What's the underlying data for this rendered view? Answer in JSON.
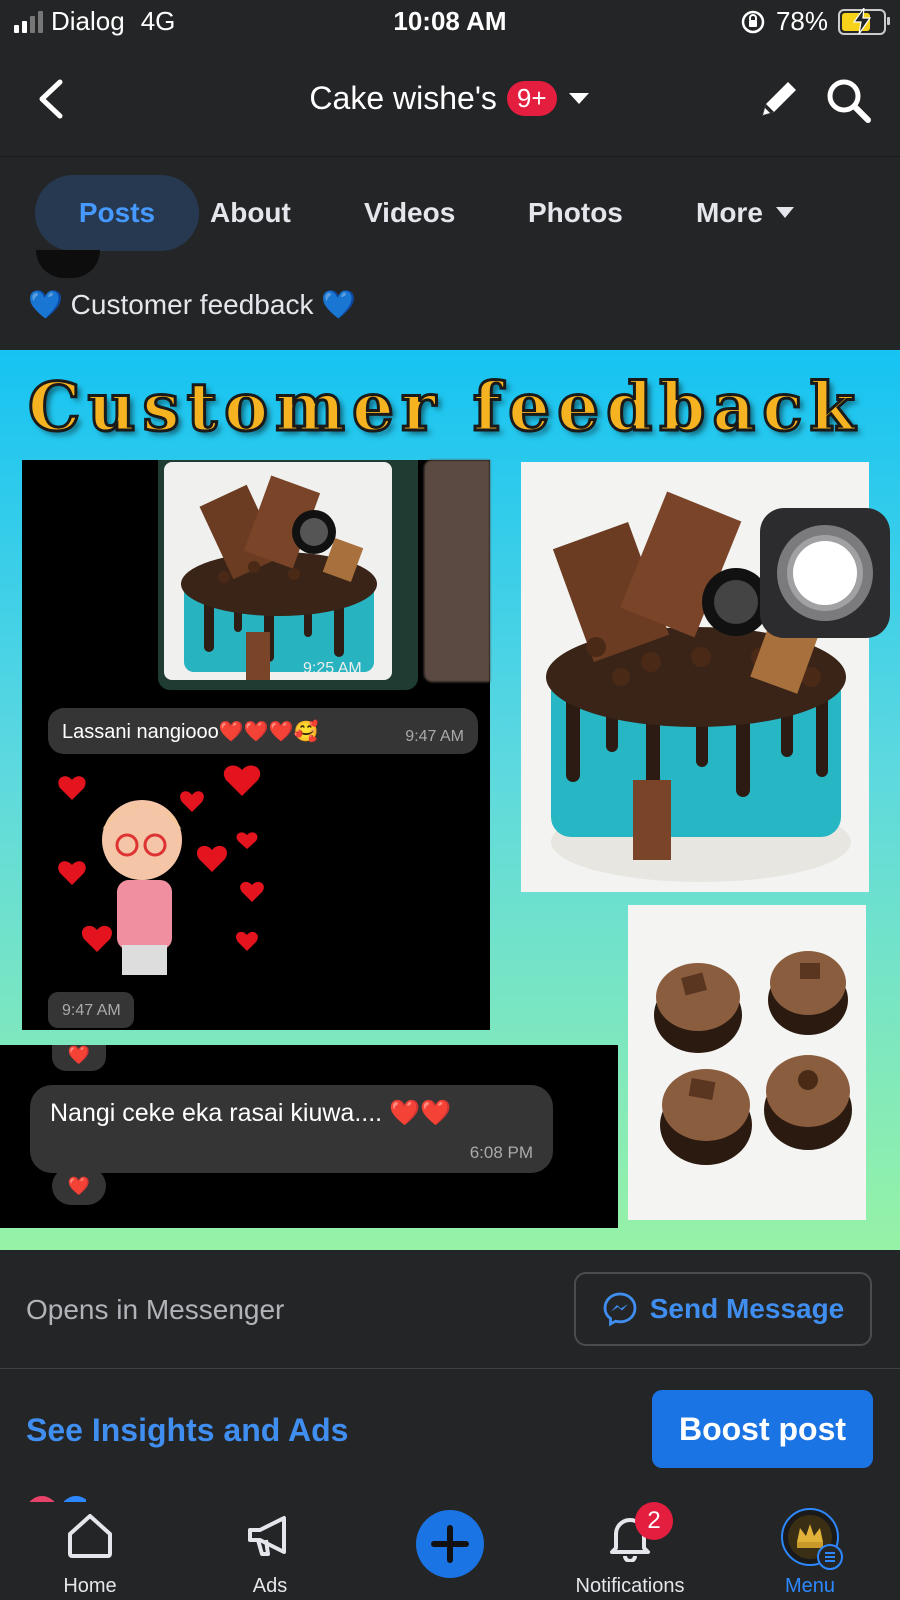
{
  "status_bar": {
    "carrier": "Dialog",
    "network": "4G",
    "time": "10:08 AM",
    "battery": "78%"
  },
  "header": {
    "title": "Cake wishe's",
    "badge": "9+"
  },
  "tabs": [
    {
      "label": "Posts",
      "active": true
    },
    {
      "label": "About",
      "active": false
    },
    {
      "label": "Videos",
      "active": false
    },
    {
      "label": "Photos",
      "active": false
    },
    {
      "label": "More",
      "active": false
    }
  ],
  "post": {
    "text_left_emoji": "💙",
    "text": "Customer feedback",
    "text_right_emoji": "💙",
    "image": {
      "title": "Customer feedback",
      "chat1": {
        "photo_time": "9:25 AM",
        "message": "Lassani  nangiooo❤️❤️❤️🥰",
        "message_time": "9:47 AM",
        "sticker_time": "9:47 AM"
      },
      "chat2": {
        "message": "Nangi  ceke eka rasai kiuwa.... ❤️❤️",
        "message_time": "6:08 PM"
      }
    }
  },
  "messenger_row": {
    "label": "Opens in Messenger",
    "button": "Send Message"
  },
  "insights_row": {
    "link": "See Insights and Ads",
    "button": "Boost post"
  },
  "bottom_nav": {
    "home": "Home",
    "ads": "Ads",
    "notifications": "Notifications",
    "notifications_badge": "2",
    "menu": "Menu"
  },
  "colors": {
    "accent": "#1b74e4",
    "link": "#3f8ef0",
    "badge": "#e41e3f",
    "background": "#242526"
  }
}
